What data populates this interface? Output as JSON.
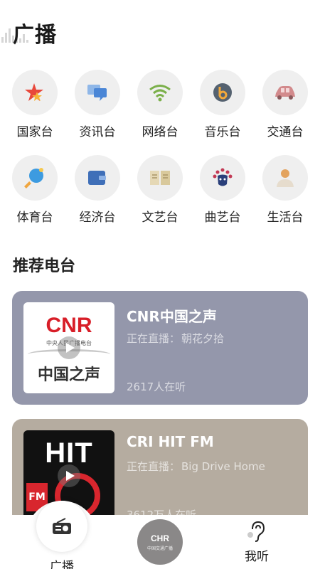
{
  "header": {
    "title": "广播"
  },
  "categories": [
    {
      "label": "国家台",
      "icon": "star-flag-icon"
    },
    {
      "label": "资讯台",
      "icon": "chat-bubbles-icon"
    },
    {
      "label": "网络台",
      "icon": "wifi-icon"
    },
    {
      "label": "音乐台",
      "icon": "music-note-icon"
    },
    {
      "label": "交通台",
      "icon": "car-icon"
    },
    {
      "label": "体育台",
      "icon": "ping-pong-paddle-icon"
    },
    {
      "label": "经济台",
      "icon": "wallet-icon"
    },
    {
      "label": "文艺台",
      "icon": "open-book-icon"
    },
    {
      "label": "曲艺台",
      "icon": "opera-mask-icon"
    },
    {
      "label": "生活台",
      "icon": "person-icon"
    }
  ],
  "recommend": {
    "title": "推荐电台",
    "stations": [
      {
        "name": "CNR中国之声",
        "live_prefix": "正在直播：",
        "live_show": "朝花夕拾",
        "listeners": "2617人在听",
        "bg": "#9497ab",
        "logo_top": "CNR",
        "logo_sub": "中央人民广播电台",
        "logo_bottom": "中国之声"
      },
      {
        "name": "CRI HIT FM",
        "live_prefix": "正在直播：",
        "live_show": "Big Drive Home",
        "listeners": "3612万人在听",
        "bg": "#b5aca0",
        "logo_top": "HIT",
        "logo_side": "FM"
      }
    ]
  },
  "tabbar": {
    "tabs": [
      {
        "label": "广播",
        "icon": "radio-icon"
      },
      {
        "label": "",
        "icon": "now-playing-disc-icon",
        "disc_text": "中国交通广播"
      },
      {
        "label": "我听",
        "icon": "ear-icon"
      }
    ]
  }
}
